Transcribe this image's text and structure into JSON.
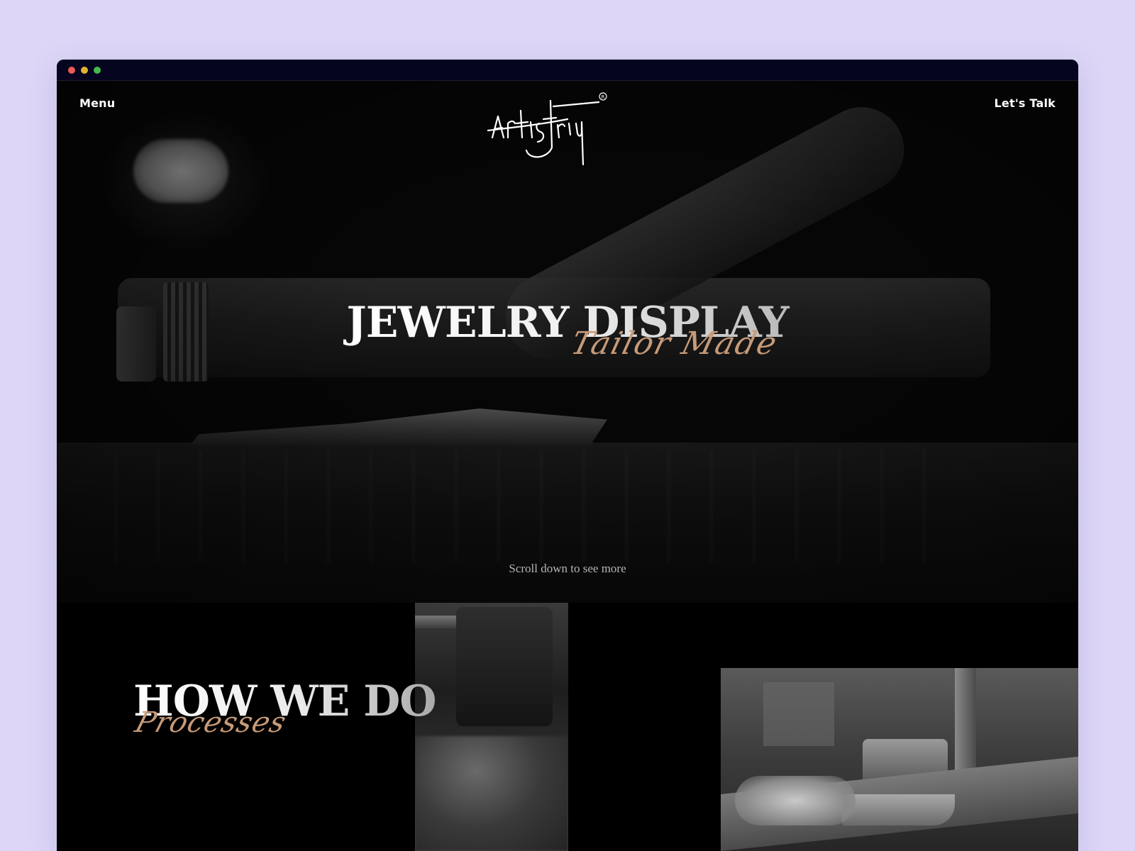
{
  "nav": {
    "menu_label": "Menu",
    "contact_label": "Let's Talk"
  },
  "brand": {
    "logo_text": "artistry"
  },
  "hero": {
    "title": "JEWELRY DISPLAY",
    "subtitle": "Tailor Made",
    "scroll_hint": "Scroll down to see more"
  },
  "process_section": {
    "title": "HOW WE DO",
    "subtitle": "Processes"
  },
  "colors": {
    "page_background": "#ddd6f7",
    "titlebar": "#05051f",
    "accent_script": "#c79a78",
    "site_background": "#000000"
  },
  "icons": {
    "window_controls": [
      "close-dot",
      "minimize-dot",
      "maximize-dot"
    ]
  }
}
